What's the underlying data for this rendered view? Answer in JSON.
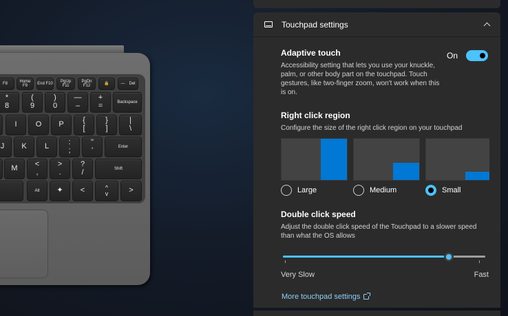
{
  "colors": {
    "accent": "#4cc2ff",
    "region_fill": "#0078d4",
    "panel_bg": "#2b2b2b"
  },
  "keyboard": {
    "fn_keys": [
      {
        "icon": "screen-icon",
        "label": "F8"
      },
      {
        "icon": "",
        "label": "Home F9"
      },
      {
        "icon": "",
        "label": "End F10"
      },
      {
        "icon": "",
        "label": "PgUp F11"
      },
      {
        "icon": "",
        "label": "PgDn F12"
      },
      {
        "icon": "lock-icon",
        "label": ""
      },
      {
        "icon": "",
        "label": "—"
      },
      {
        "icon": "",
        "label": "Del"
      }
    ],
    "row1": [
      "*\n8",
      "(\n9",
      ")\n0",
      "—\n–",
      "+\n=",
      "Backspace"
    ],
    "row2": [
      "I",
      "O",
      "P",
      "{\n[",
      "}\n]",
      "|\n\\"
    ],
    "row3": [
      "J",
      "K",
      "L",
      ":\n;",
      "\"\n'",
      "Enter"
    ],
    "row4": [
      "M",
      "<\n,",
      ">\n.",
      "?\n/",
      "Shift"
    ],
    "row5": [
      "Alt",
      "",
      "<",
      "^\nv",
      ">"
    ]
  },
  "panel": {
    "title": "Touchpad settings",
    "adaptive_touch": {
      "title": "Adaptive touch",
      "description": "Accessibility setting that lets you use your knuckle, palm, or other body part on the touchpad. Touch gestures, like two-finger zoom, won't work when this is on.",
      "state_label": "On",
      "enabled": true
    },
    "right_click_region": {
      "title": "Right click region",
      "description": "Configure the size of the right click region on your touchpad",
      "options": [
        {
          "label": "Large",
          "selected": false,
          "fill_width": 0.4,
          "fill_height": 1.0
        },
        {
          "label": "Medium",
          "selected": false,
          "fill_width": 0.4,
          "fill_height": 0.42
        },
        {
          "label": "Small",
          "selected": true,
          "fill_width": 0.4,
          "fill_height": 0.2
        }
      ]
    },
    "double_click_speed": {
      "title": "Double click speed",
      "description": "Adjust the double click speed of the Touchpad to a slower speed than what the OS allows",
      "min_label": "Very Slow",
      "max_label": "Fast",
      "value": 0.82
    },
    "more_link": "More touchpad settings"
  }
}
